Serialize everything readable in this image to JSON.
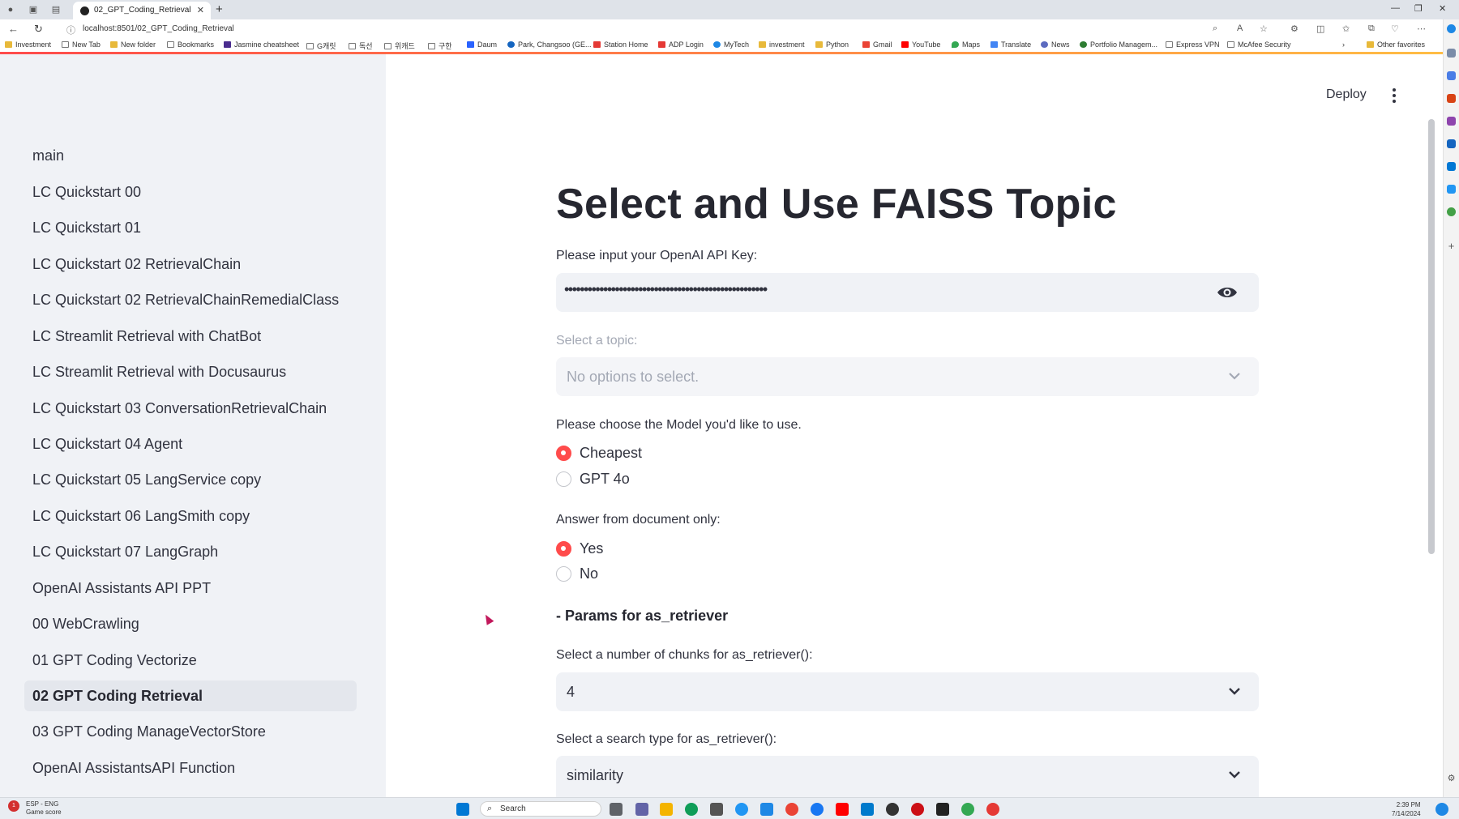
{
  "browser": {
    "tab_title": "02_GPT_Coding_Retrieval",
    "url": "localhost:8501/02_GPT_Coding_Retrieval",
    "bookmarks": [
      "Investment",
      "New Tab",
      "New folder",
      "Bookmarks",
      "Jasmine cheatsheet",
      "G캐릿",
      "독선",
      "위캐드",
      "구한",
      "Daum",
      "Park, Changsoo (GE...",
      "Station Home",
      "ADP Login",
      "MyTech",
      "investment",
      "Python",
      "Gmail",
      "YouTube",
      "Maps",
      "Translate",
      "News",
      "Portfolio Managem...",
      "Express VPN",
      "McAfee Security"
    ],
    "other_favorites": "Other favorites"
  },
  "sidebar": {
    "items": [
      {
        "label": "main",
        "active": false
      },
      {
        "label": "LC Quickstart 00",
        "active": false
      },
      {
        "label": "LC Quickstart 01",
        "active": false
      },
      {
        "label": "LC Quickstart 02 RetrievalChain",
        "active": false
      },
      {
        "label": "LC Quickstart 02 RetrievalChainRemedialClass",
        "active": false
      },
      {
        "label": "LC Streamlit Retrieval with ChatBot",
        "active": false
      },
      {
        "label": "LC Streamlit Retrieval with Docusaurus",
        "active": false
      },
      {
        "label": "LC Quickstart 03 ConversationRetrievalChain",
        "active": false
      },
      {
        "label": "LC Quickstart 04 Agent",
        "active": false
      },
      {
        "label": "LC Quickstart 05 LangService copy",
        "active": false
      },
      {
        "label": "LC Quickstart 06 LangSmith copy",
        "active": false
      },
      {
        "label": "LC Quickstart 07 LangGraph",
        "active": false
      },
      {
        "label": "OpenAI Assistants API PPT",
        "active": false
      },
      {
        "label": "00 WebCrawling",
        "active": false
      },
      {
        "label": "01 GPT Coding Vectorize",
        "active": false
      },
      {
        "label": "02 GPT Coding Retrieval",
        "active": true
      },
      {
        "label": "03 GPT Coding ManageVectorStore",
        "active": false
      },
      {
        "label": "OpenAI AssistantsAPI Function",
        "active": false
      }
    ]
  },
  "header": {
    "deploy_label": "Deploy"
  },
  "main": {
    "title": "Select and Use FAISS Topic",
    "api_key_label": "Please input your OpenAI API Key:",
    "api_key_masked": "••••••••••••••••••••••••••••••••••••••••••••••••••••",
    "topic_label": "Select a topic:",
    "topic_placeholder": "No options to select.",
    "model_label": "Please choose the Model you'd like to use.",
    "model_options": [
      {
        "label": "Cheapest",
        "selected": true
      },
      {
        "label": "GPT 4o",
        "selected": false
      }
    ],
    "doc_only_label": "Answer from document only:",
    "doc_only_options": [
      {
        "label": "Yes",
        "selected": true
      },
      {
        "label": "No",
        "selected": false
      }
    ],
    "params_heading": "- Params for as_retriever",
    "chunks_label": "Select a number of chunks for as_retriever():",
    "chunks_value": "4",
    "search_type_label": "Select a search type for as_retriever():",
    "search_type_value": "similarity"
  },
  "taskbar": {
    "weather_line1": "ESP - ENG",
    "weather_line2": "Game score",
    "badge": "1",
    "search_text": "Search",
    "time": "2:39 PM",
    "date": "7/14/2024"
  },
  "colors": {
    "accent": "#ff4b4b",
    "sidebar_bg": "#f0f2f6",
    "text": "#31333f"
  }
}
